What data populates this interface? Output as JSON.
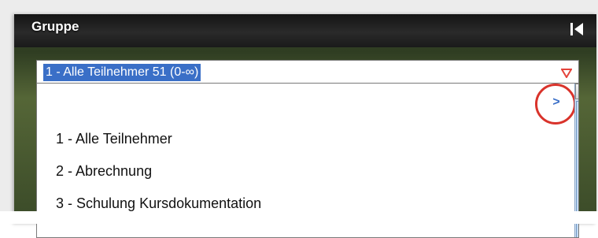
{
  "panel": {
    "title": "Gruppe",
    "collapse_icon": "collapse-left-icon"
  },
  "select": {
    "value": "1 - Alle Teilnehmer 51 (0-∞)",
    "arrow_icon": "triangle-down-icon",
    "arrow_color": "#e4433b",
    "selection_color": "#3a6fc7"
  },
  "dropdown": {
    "expand_label": ">",
    "highlight_circle_color": "#d9332b",
    "items": [
      {
        "label": "1 - Alle Teilnehmer"
      },
      {
        "label": "2 - Abrechnung"
      },
      {
        "label": "3 - Schulung Kursdokumentation"
      }
    ]
  }
}
